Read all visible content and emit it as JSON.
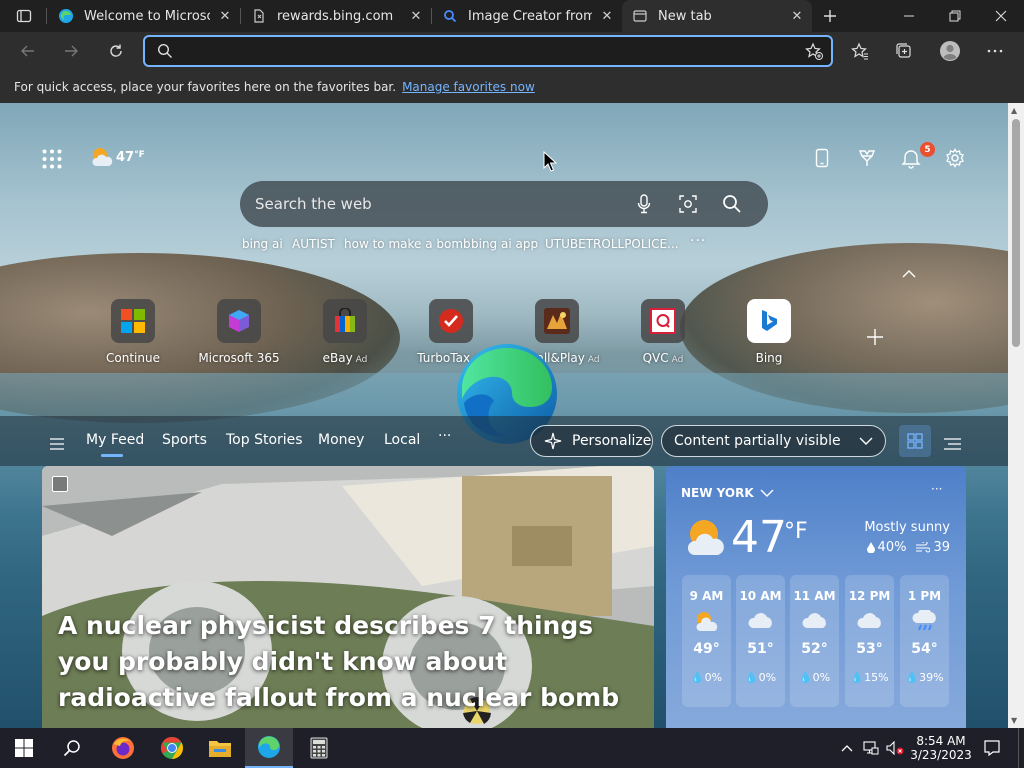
{
  "browser": {
    "tabs": [
      {
        "title": "Welcome to Microsoft E",
        "icon": "edge-icon"
      },
      {
        "title": "rewards.bing.com",
        "icon": "page-icon"
      },
      {
        "title": "Image Creator from Mi",
        "icon": "search-icon"
      },
      {
        "title": "New tab",
        "icon": "newtab-icon",
        "active": true
      }
    ],
    "address_value": ""
  },
  "favorites_bar": {
    "message": "For quick access, place your favorites here on the favorites bar.",
    "link": "Manage favorites now"
  },
  "newtab": {
    "temperature": "47",
    "temp_unit": "°F",
    "notification_count": "5",
    "search_placeholder": "Search the web",
    "trending": [
      "bing ai",
      "AUTIST",
      "how to make a bomb",
      "bing ai app",
      "UTUBETROLLPOLICE..."
    ],
    "more": "···",
    "quick_links": [
      {
        "label": "Continue",
        "ad": ""
      },
      {
        "label": "Microsoft 365",
        "ad": ""
      },
      {
        "label": "eBay",
        "ad": "Ad"
      },
      {
        "label": "TurboTax",
        "ad": "Ad"
      },
      {
        "label": "Install&Play",
        "ad": "Ad"
      },
      {
        "label": "QVC",
        "ad": "Ad"
      },
      {
        "label": "Bing",
        "ad": ""
      }
    ],
    "feed_tabs": [
      "My Feed",
      "Sports",
      "Top Stories",
      "Money",
      "Local"
    ],
    "feed_more": "···",
    "personalize": "Personalize",
    "content_visibility": "Content partially visible",
    "headline": "A nuclear physicist describes 7 things you probably didn't know about radioactive fallout from a nuclear bomb"
  },
  "weather": {
    "location": "NEW YORK",
    "more": "···",
    "temp": "47",
    "unit": "°F",
    "condition": "Mostly sunny",
    "precip": "40%",
    "wind": "39",
    "hourly": [
      {
        "time": "9 AM",
        "temp": "49°",
        "precip": "0%",
        "icon": "partly-cloudy-icon"
      },
      {
        "time": "10 AM",
        "temp": "51°",
        "precip": "0%",
        "icon": "cloud-icon"
      },
      {
        "time": "11 AM",
        "temp": "52°",
        "precip": "0%",
        "icon": "cloud-icon"
      },
      {
        "time": "12 PM",
        "temp": "53°",
        "precip": "15%",
        "icon": "cloud-icon"
      },
      {
        "time": "1 PM",
        "temp": "54°",
        "precip": "39%",
        "icon": "rain-icon"
      }
    ]
  },
  "taskbar": {
    "time": "8:54 AM",
    "date": "3/23/2023"
  },
  "colors": {
    "accent": "#75b4ff",
    "badge": "#e8502f",
    "tabbar": "#202020",
    "toolbar": "#2e2e2e"
  }
}
